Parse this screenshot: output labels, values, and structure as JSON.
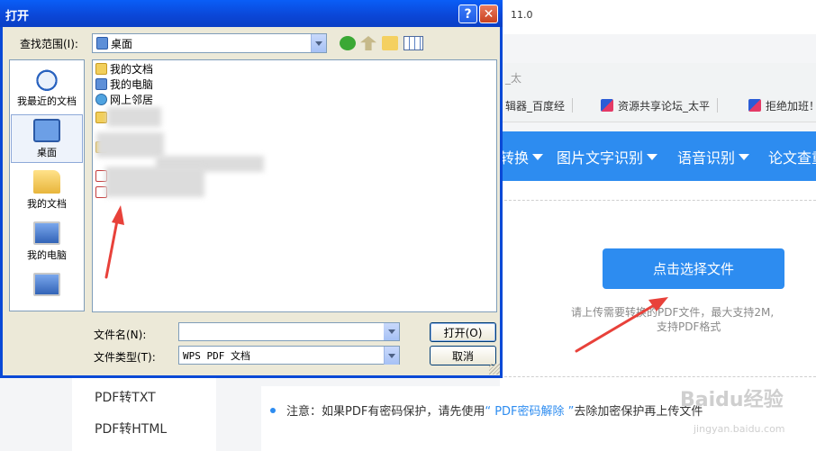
{
  "background": {
    "topbar_text": "11.0",
    "old_tab_text": "_太",
    "tabs": [
      {
        "label": "辑器_百度经"
      },
      {
        "label": "资源共享论坛_太平"
      },
      {
        "label": "拒绝加班！"
      }
    ],
    "nav_items": [
      "转换",
      "图片文字识别",
      "语音识别",
      "论文查重"
    ],
    "upload_button": "点击选择文件",
    "hint_line1": "请上传需要转换的PDF文件，最大支持2M,",
    "hint_line2": "支持PDF格式",
    "side_links": [
      "PDF转TXT",
      "PDF转HTML"
    ],
    "notice_prefix": "注意：如果PDF有密码保护，请先使用",
    "notice_link": "“ PDF密码解除 ”",
    "notice_suffix": "去除加密保护再上传文件",
    "watermark": "Baidu经验",
    "watermark_sub": "jingyan.baidu.com"
  },
  "dialog": {
    "title": "打开",
    "help_label": "?",
    "close_label": "✕",
    "lookin_label": "查找范围(I):",
    "lookin_value": "桌面",
    "places": [
      {
        "label": "我最近的文档",
        "icon": "recent-docs-icon"
      },
      {
        "label": "桌面",
        "icon": "desktop-icon",
        "active": true
      },
      {
        "label": "我的文档",
        "icon": "my-documents-icon"
      },
      {
        "label": "我的电脑",
        "icon": "my-computer-icon"
      },
      {
        "label": "",
        "icon": "network-places-icon"
      }
    ],
    "files": [
      {
        "label": "我的文档",
        "icon": "folder-icon"
      },
      {
        "label": "我的电脑",
        "icon": "computer-icon"
      },
      {
        "label": "网上邻居",
        "icon": "network-icon"
      }
    ],
    "filename_label": "文件名(N):",
    "filename_value": "",
    "filetype_label": "文件类型(T):",
    "filetype_value": "WPS PDF 文档",
    "open_button": "打开(O)",
    "cancel_button": "取消"
  },
  "colors": {
    "accent_blue": "#2d8cf0",
    "xp_title": "#0a5ef7",
    "annotation_red": "#e8413a"
  }
}
